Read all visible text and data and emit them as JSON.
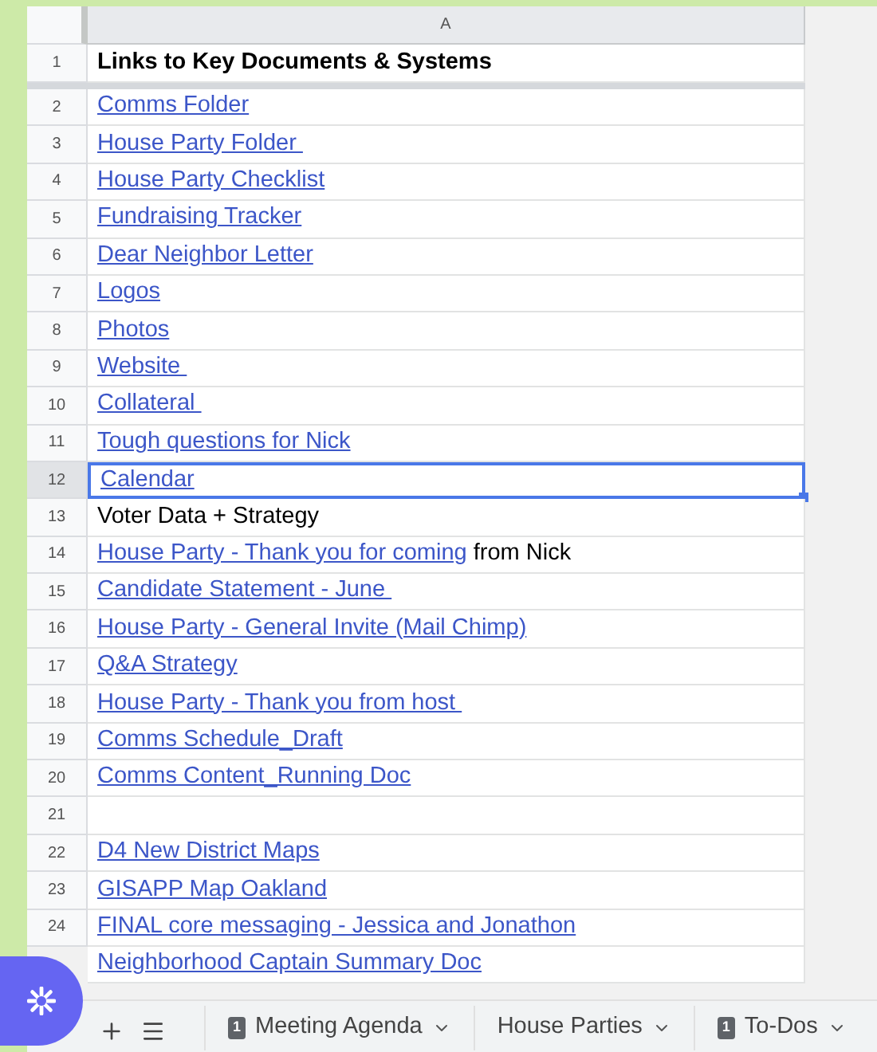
{
  "column_header": "A",
  "rows": [
    {
      "number": "1",
      "selected": false,
      "parts": [
        {
          "kind": "header",
          "text": "Links to Key Documents & Systems"
        }
      ]
    },
    {
      "number": "2",
      "selected": false,
      "parts": [
        {
          "kind": "link",
          "text": "Comms Folder"
        }
      ]
    },
    {
      "number": "3",
      "selected": false,
      "parts": [
        {
          "kind": "link",
          "text": "House Party Folder "
        }
      ]
    },
    {
      "number": "4",
      "selected": false,
      "parts": [
        {
          "kind": "link",
          "text": "House Party Checklist"
        }
      ]
    },
    {
      "number": "5",
      "selected": false,
      "parts": [
        {
          "kind": "link",
          "text": "Fundraising Tracker"
        }
      ]
    },
    {
      "number": "6",
      "selected": false,
      "parts": [
        {
          "kind": "link",
          "text": "Dear Neighbor Letter"
        }
      ]
    },
    {
      "number": "7",
      "selected": false,
      "parts": [
        {
          "kind": "link",
          "text": "Logos"
        }
      ]
    },
    {
      "number": "8",
      "selected": false,
      "parts": [
        {
          "kind": "link",
          "text": "Photos"
        }
      ]
    },
    {
      "number": "9",
      "selected": false,
      "parts": [
        {
          "kind": "link",
          "text": "Website "
        }
      ]
    },
    {
      "number": "10",
      "selected": false,
      "parts": [
        {
          "kind": "link",
          "text": "Collateral "
        }
      ]
    },
    {
      "number": "11",
      "selected": false,
      "parts": [
        {
          "kind": "link",
          "text": "Tough questions for Nick"
        }
      ]
    },
    {
      "number": "12",
      "selected": true,
      "parts": [
        {
          "kind": "link",
          "text": "Calendar"
        }
      ]
    },
    {
      "number": "13",
      "selected": false,
      "parts": [
        {
          "kind": "text",
          "text": "Voter Data + Strategy"
        }
      ]
    },
    {
      "number": "14",
      "selected": false,
      "parts": [
        {
          "kind": "link",
          "text": "House Party - Thank you for coming"
        },
        {
          "kind": "text",
          "text": " from Nick"
        }
      ]
    },
    {
      "number": "15",
      "selected": false,
      "parts": [
        {
          "kind": "link",
          "text": "Candidate Statement - June "
        }
      ]
    },
    {
      "number": "16",
      "selected": false,
      "parts": [
        {
          "kind": "link",
          "text": "House Party - General Invite (Mail Chimp)"
        }
      ]
    },
    {
      "number": "17",
      "selected": false,
      "parts": [
        {
          "kind": "link",
          "text": "Q&A Strategy"
        }
      ]
    },
    {
      "number": "18",
      "selected": false,
      "parts": [
        {
          "kind": "link",
          "text": "House Party - Thank you from host "
        }
      ]
    },
    {
      "number": "19",
      "selected": false,
      "parts": [
        {
          "kind": "link",
          "text": "Comms Schedule_Draft"
        }
      ]
    },
    {
      "number": "20",
      "selected": false,
      "parts": [
        {
          "kind": "link",
          "text": "Comms Content_Running Doc"
        }
      ]
    },
    {
      "number": "21",
      "selected": false,
      "parts": []
    },
    {
      "number": "22",
      "selected": false,
      "parts": [
        {
          "kind": "link",
          "text": "D4 New District Maps"
        }
      ]
    },
    {
      "number": "23",
      "selected": false,
      "parts": [
        {
          "kind": "link",
          "text": "GISAPP Map Oakland"
        }
      ]
    },
    {
      "number": "24",
      "selected": false,
      "parts": [
        {
          "kind": "link",
          "text": "FINAL core messaging - Jessica and Jonathon"
        }
      ]
    },
    {
      "selected": false,
      "parts": [
        {
          "kind": "link",
          "text": "Neighborhood Captain Summary Doc"
        }
      ]
    }
  ],
  "sheet_tabs": [
    {
      "label": "Meeting Agenda",
      "badge": "1"
    },
    {
      "label": "House Parties"
    },
    {
      "label": "To-Dos",
      "badge": "1"
    }
  ]
}
